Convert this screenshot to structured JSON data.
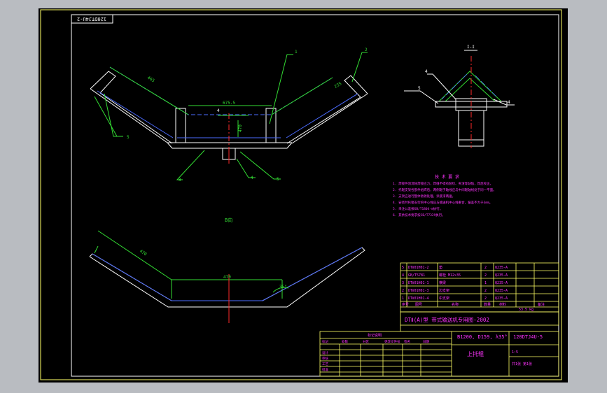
{
  "drawing": {
    "stamp": "120DTJ4U-2",
    "title_main": "DTⅡ(A)型    带式输送机专用图-2002",
    "spec_label": "B1200, D159, λ35°",
    "drawing_no": "120DTJ4U-5",
    "part_name": "上托辊",
    "section_label": "I-I",
    "view_label": "B向",
    "notes_title": "技 术 要 求",
    "notes": [
      "1. 焊接件须消除焊接应力，焊缝不得有裂纹、夹渣等缺陷，焊后校正。",
      "2. 托辊支架各部件组焊后，两侧辊子轴线应与中间辊轴线处于同一平面。",
      "3. 支架应进行整体防锈处理，涂底漆两遍。",
      "4. 安装时托辊支架的中心线应与输送机中心线重合，偏差不大于3mm。",
      "5. 未注公差按GB/T1804-m执行。",
      "6. 其余技术要求按JB/T7329执行。"
    ],
    "leaders": [
      "1",
      "2",
      "3",
      "4",
      "5"
    ],
    "weld_symbols": [
      "4",
      "5",
      "4"
    ],
    "dims": {
      "side_roller_length": "465",
      "center_roller_length": "470",
      "bracket_width": "235",
      "center_gap": "675.5",
      "lower_side": "470",
      "lower_center": "470",
      "trough_angle": "35°"
    },
    "bom": {
      "rows": [
        {
          "no": "5",
          "code": "DTⅡ01H01-2",
          "name": "垫",
          "qty": "2",
          "mat": "Q235-A"
        },
        {
          "no": "4",
          "code": "GB/T5781",
          "name": "螺栓 M12×35",
          "qty": "2",
          "mat": "Q235-A"
        },
        {
          "no": "3",
          "code": "DTⅡ01H01-1",
          "name": "横梁",
          "qty": "1",
          "mat": "Q235-A"
        },
        {
          "no": "2",
          "code": "DTⅡ01H01-3",
          "name": "边支架",
          "qty": "2",
          "mat": "Q235-A"
        },
        {
          "no": "1",
          "code": "DTⅡ01H01-4",
          "name": "中支架",
          "qty": "2",
          "mat": "Q235-A"
        }
      ],
      "header": [
        "序号",
        "图号",
        "名称",
        "数量",
        "材料",
        "备注"
      ],
      "weight": "53.5 kg"
    },
    "revision": {
      "title": "标记说明",
      "rows": [
        "标记",
        "处数",
        "分区",
        "更改文件号",
        "签名",
        "日期"
      ],
      "roles": [
        "设计",
        "审核",
        "工艺",
        "批准"
      ]
    },
    "scale": "1:5",
    "sheet": "共1张 第1张"
  }
}
